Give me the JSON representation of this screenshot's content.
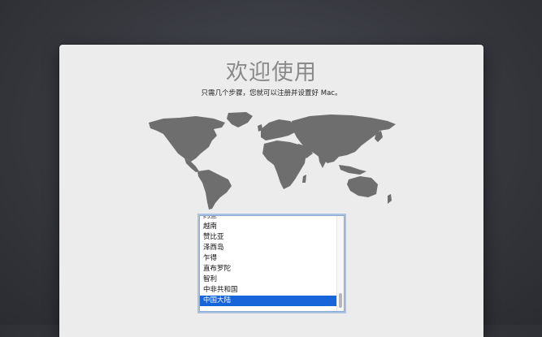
{
  "setup": {
    "title": "欢迎使用",
    "subtitle": "只需几个步骤，您就可以注册并设置好 Mac。"
  },
  "country_list": {
    "items": [
      "约旦",
      "越南",
      "赞比亚",
      "泽西岛",
      "乍得",
      "直布罗陀",
      "智利",
      "中非共和国",
      "中国大陆"
    ],
    "selected": "中国大陆"
  },
  "colors": {
    "map_land": "#6e6e6e",
    "selection": "#1765d8"
  }
}
